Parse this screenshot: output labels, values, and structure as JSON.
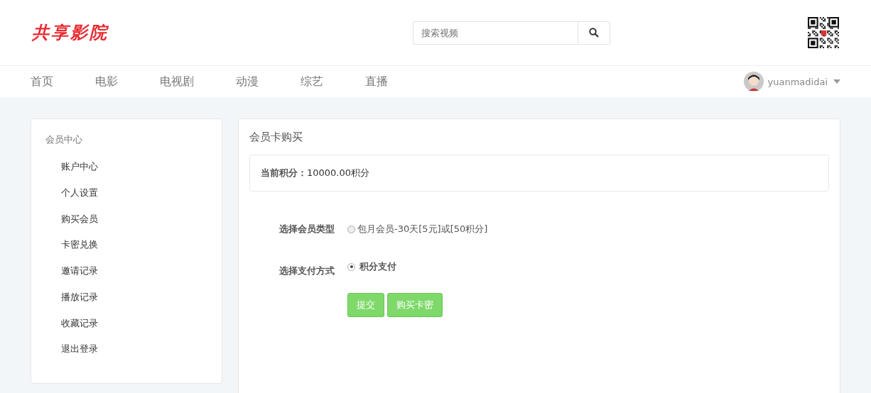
{
  "header": {
    "logo": "共享影院",
    "search": {
      "placeholder": "搜索视频"
    }
  },
  "nav": {
    "items": [
      {
        "label": "首页",
        "selected": false
      },
      {
        "label": "电影",
        "selected": false
      },
      {
        "label": "电视剧",
        "selected": false
      },
      {
        "label": "动漫",
        "selected": false
      },
      {
        "label": "综艺",
        "selected": false
      },
      {
        "label": "直播",
        "selected": false
      }
    ],
    "user": "yuanmadidai"
  },
  "sidebar": {
    "title": "会员中心",
    "items": [
      {
        "label": "账户中心",
        "selected": false
      },
      {
        "label": "个人设置",
        "selected": false
      },
      {
        "label": "购买会员",
        "selected": false
      },
      {
        "label": "卡密兑换",
        "selected": false
      },
      {
        "label": "邀请记录",
        "selected": false
      },
      {
        "label": "播放记录",
        "selected": false
      },
      {
        "label": "收藏记录",
        "selected": false
      },
      {
        "label": "退出登录",
        "selected": false
      }
    ]
  },
  "main": {
    "title": "会员卡购买",
    "points_label": "当前积分：",
    "points_value": "10000.00积分",
    "fields": [
      {
        "label": "选择会员类型",
        "option": {
          "label": "包月会员-30天[5元]或[50积分]",
          "checked": false,
          "bold": false
        }
      },
      {
        "label": "选择支付方式",
        "option": {
          "label": "积分支付",
          "checked": true,
          "bold": true
        }
      }
    ],
    "buttons": [
      "提交",
      "购买卡密"
    ]
  }
}
